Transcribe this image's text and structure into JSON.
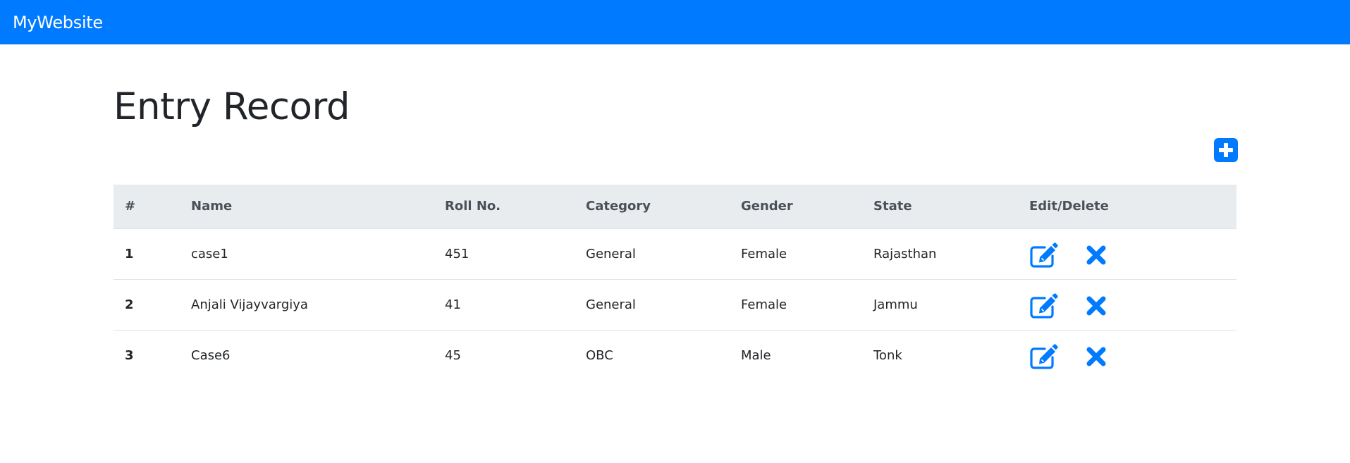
{
  "navbar": {
    "brand": "MyWebsite",
    "color": "#007bff"
  },
  "page": {
    "title": "Entry Record"
  },
  "add_button": {
    "icon": "plus-square-icon"
  },
  "table": {
    "headers": [
      "#",
      "Name",
      "Roll No.",
      "Category",
      "Gender",
      "State",
      "Edit/Delete"
    ],
    "rows": [
      {
        "num": "1",
        "name": "case1",
        "roll": "451",
        "category": "General",
        "gender": "Female",
        "state": "Rajasthan"
      },
      {
        "num": "2",
        "name": "Anjali Vijayvargiya",
        "roll": "41",
        "category": "General",
        "gender": "Female",
        "state": "Jammu"
      },
      {
        "num": "3",
        "name": "Case6",
        "roll": "45",
        "category": "OBC",
        "gender": "Male",
        "state": "Tonk"
      }
    ],
    "edit_icon": "edit-icon",
    "delete_icon": "close-icon"
  }
}
